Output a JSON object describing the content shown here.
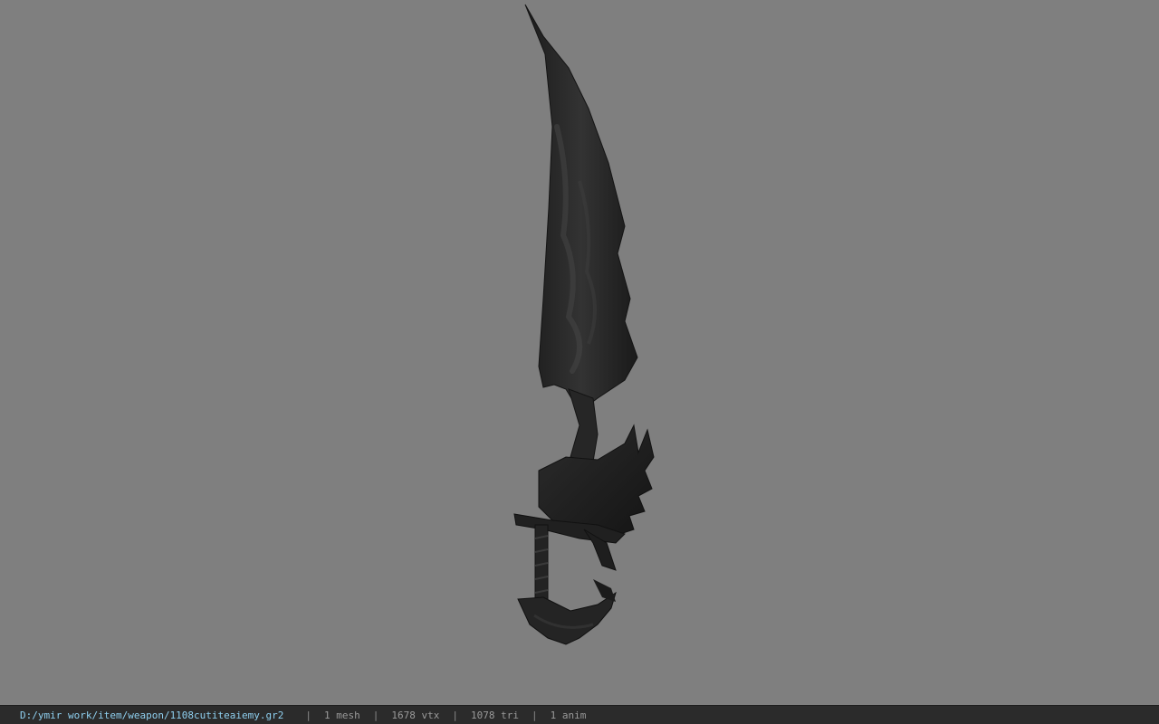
{
  "viewer": {
    "background_color": "#7f7f7f",
    "model_icon": "blade-model"
  },
  "status": {
    "path": "D:/ymir work/item/weapon/1108cutiteaiemy.gr2",
    "separator": "|",
    "meshes": "1 mesh",
    "vertices": "1678 vtx",
    "triangles": "1078 tri",
    "animations": "1 anim"
  },
  "colors": {
    "status_bg": "#2b2b2b",
    "path_text": "#8fd0f0",
    "stat_text": "#9a9a9a"
  }
}
